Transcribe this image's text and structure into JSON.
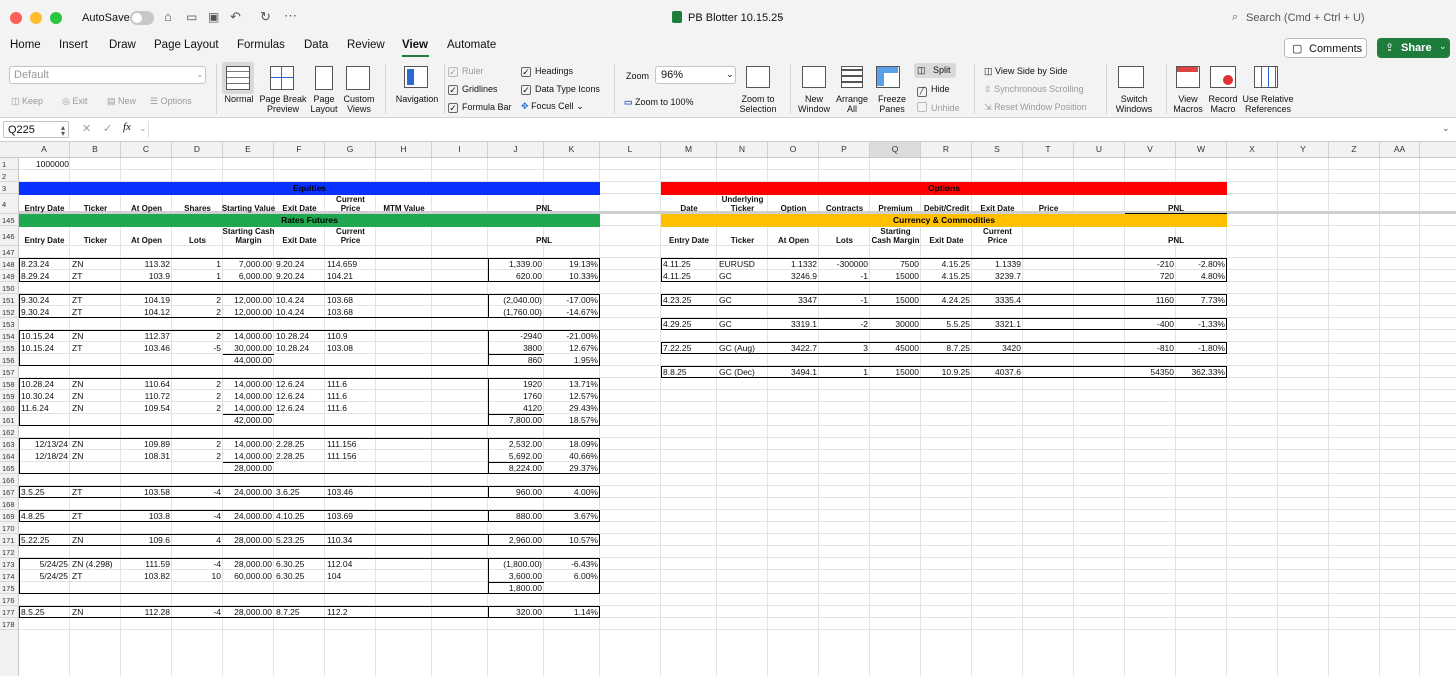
{
  "titlebar": {
    "autosave": "AutoSave",
    "doc_title": "PB Blotter  10.15.25",
    "search_placeholder": "Search (Cmd + Ctrl + U)"
  },
  "tabs": [
    "Home",
    "Insert",
    "Draw",
    "Page Layout",
    "Formulas",
    "Data",
    "Review",
    "View",
    "Automate"
  ],
  "active_tab": "View",
  "comments_label": "Comments",
  "share_label": "Share",
  "ribbon": {
    "sheet_view_value": "Default",
    "keep": "Keep",
    "exit": "Exit",
    "new": "New",
    "options": "Options",
    "normal": "Normal",
    "page_break": "Page Break\nPreview",
    "page_layout": "Page\nLayout",
    "custom_views": "Custom\nViews",
    "navigation": "Navigation",
    "ruler": "Ruler",
    "gridlines": "Gridlines",
    "formula_bar": "Formula Bar",
    "headings": "Headings",
    "data_type_icons": "Data Type Icons",
    "focus_cell": "Focus Cell",
    "zoom_label": "Zoom",
    "zoom_value": "96%",
    "zoom_100": "Zoom to 100%",
    "zoom_sel": "Zoom to\nSelection",
    "new_window": "New\nWindow",
    "arrange_all": "Arrange\nAll",
    "freeze": "Freeze\nPanes",
    "split": "Split",
    "hide": "Hide",
    "unhide": "Unhide",
    "side_by_side": "View Side by Side",
    "sync_scroll": "Synchronous Scrolling",
    "reset_pos": "Reset Window Position",
    "switch": "Switch\nWindows",
    "view_macros": "View\nMacros",
    "record_macro": "Record\nMacro",
    "relative": "Use Relative\nReferences"
  },
  "formula": {
    "name_box": "Q225",
    "fx": "fx",
    "content": ""
  },
  "columns": [
    "A",
    "B",
    "C",
    "D",
    "E",
    "F",
    "G",
    "H",
    "I",
    "J",
    "K",
    "L",
    "M",
    "N",
    "O",
    "P",
    "Q",
    "R",
    "S",
    "T",
    "U",
    "V",
    "W",
    "X",
    "Y",
    "Z",
    "AA"
  ],
  "rows": [
    "1",
    "2",
    "3",
    "4",
    "145",
    "146",
    "147",
    "148",
    "149",
    "150",
    "151",
    "152",
    "153",
    "154",
    "155",
    "156",
    "157",
    "158",
    "159",
    "160",
    "161",
    "162",
    "163",
    "164",
    "165",
    "166",
    "167",
    "168",
    "169",
    "170",
    "171",
    "172",
    "173",
    "174",
    "175",
    "176",
    "177",
    "178"
  ],
  "a1_value": "1000000",
  "sections": {
    "equities": "Equities",
    "options": "Options",
    "rates": "Rates Futures",
    "currency": "Currency & Commodities"
  },
  "equity_headers": [
    "Entry Date",
    "Ticker",
    "At Open",
    "Shares",
    "Starting Value",
    "Exit Date",
    "Current\nPrice",
    "MTM Value",
    "PNL"
  ],
  "options_headers": [
    "Date",
    "Underlying\nTicker",
    "Option",
    "Contracts",
    "Premium",
    "Debit/Credit",
    "Exit Date",
    "Price",
    "PNL"
  ],
  "rates_headers": [
    "Entry Date",
    "Ticker",
    "At Open",
    "Lots",
    "Starting Cash\nMargin",
    "Exit Date",
    "Current\nPrice",
    "PNL"
  ],
  "cc_headers": [
    "Entry Date",
    "Ticker",
    "At Open",
    "Lots",
    "Starting\nCash Margin",
    "Exit Date",
    "Current\nPrice",
    "PNL"
  ],
  "rates_rows": [
    {
      "row": 148,
      "a": "8.23.24",
      "b": "ZN",
      "c": "113.32",
      "d": "1",
      "e": "7,000.00",
      "f": "9.20.24",
      "g": "114.659",
      "j": "1,339.00",
      "k": "19.13%"
    },
    {
      "row": 149,
      "a": "8.29.24",
      "b": "ZT",
      "c": "103.9",
      "d": "1",
      "e": "6,000.00",
      "f": "9.20.24",
      "g": "104.21",
      "j": "620.00",
      "k": "10.33%"
    },
    {
      "row": 151,
      "a": "9.30.24",
      "b": "ZT",
      "c": "104.19",
      "d": "2",
      "e": "12,000.00",
      "f": "10.4.24",
      "g": "103.68",
      "j": "(2,040.00)",
      "k": "-17.00%"
    },
    {
      "row": 152,
      "a": "9.30.24",
      "b": "ZT",
      "c": "104.12",
      "d": "2",
      "e": "12,000.00",
      "f": "10.4.24",
      "g": "103.68",
      "j": "(1,760.00)",
      "k": "-14.67%"
    },
    {
      "row": 154,
      "a": "10.15.24",
      "b": "ZN",
      "c": "112.37",
      "d": "2",
      "e": "14,000.00",
      "f": "10.28.24",
      "g": "110.9",
      "j": "-2940",
      "k": "-21.00%"
    },
    {
      "row": 155,
      "a": "10.15.24",
      "b": "ZT",
      "c": "103.46",
      "d": "-5",
      "e": "30,000.00",
      "f": "10.28.24",
      "g": "103.08",
      "j": "3800",
      "k": "12.67%"
    },
    {
      "row": 156,
      "a": "",
      "b": "",
      "c": "",
      "d": "",
      "e": "44,000.00",
      "f": "",
      "g": "",
      "j": "860",
      "k": "1.95%"
    },
    {
      "row": 158,
      "a": "10.28.24",
      "b": "ZN",
      "c": "110.64",
      "d": "2",
      "e": "14,000.00",
      "f": "12.6.24",
      "g": "111.6",
      "j": "1920",
      "k": "13.71%"
    },
    {
      "row": 159,
      "a": "10.30.24",
      "b": "ZN",
      "c": "110.72",
      "d": "2",
      "e": "14,000.00",
      "f": "12.6.24",
      "g": "111.6",
      "j": "1760",
      "k": "12.57%"
    },
    {
      "row": 160,
      "a": "11.6.24",
      "b": "ZN",
      "c": "109.54",
      "d": "2",
      "e": "14,000.00",
      "f": "12.6.24",
      "g": "111.6",
      "j": "4120",
      "k": "29.43%"
    },
    {
      "row": 161,
      "a": "",
      "b": "",
      "c": "",
      "d": "",
      "e": "42,000.00",
      "f": "",
      "g": "",
      "j": "7,800.00",
      "k": "18.57%"
    },
    {
      "row": 163,
      "a": "12/13/24",
      "b": "ZN",
      "c": "109.89",
      "d": "2",
      "e": "14,000.00",
      "f": "2.28.25",
      "g": "111.156",
      "j": "2,532.00",
      "k": "18.09%",
      "ar": true
    },
    {
      "row": 164,
      "a": "12/18/24",
      "b": "ZN",
      "c": "108.31",
      "d": "2",
      "e": "14,000.00",
      "f": "2.28.25",
      "g": "111.156",
      "j": "5,692.00",
      "k": "40.66%",
      "ar": true
    },
    {
      "row": 165,
      "a": "",
      "b": "",
      "c": "",
      "d": "",
      "e": "28,000.00",
      "f": "",
      "g": "",
      "j": "8,224.00",
      "k": "29.37%"
    },
    {
      "row": 167,
      "a": "3.5.25",
      "b": "ZT",
      "c": "103.58",
      "d": "-4",
      "e": "24,000.00",
      "f": "3.6.25",
      "g": "103.46",
      "j": "960.00",
      "k": "4.00%"
    },
    {
      "row": 169,
      "a": "4.8.25",
      "b": "ZT",
      "c": "103.8",
      "d": "-4",
      "e": "24,000.00",
      "f": "4.10.25",
      "g": "103.69",
      "j": "880.00",
      "k": "3.67%"
    },
    {
      "row": 171,
      "a": "5.22.25",
      "b": "ZN",
      "c": "109.6",
      "d": "4",
      "e": "28,000.00",
      "f": "5.23.25",
      "g": "110.34",
      "j": "2,960.00",
      "k": "10.57%"
    },
    {
      "row": 173,
      "a": "5/24/25",
      "b": "ZN (4.298)",
      "c": "111.59",
      "d": "-4",
      "e": "28,000.00",
      "f": "6.30.25",
      "g": "112.04",
      "j": "(1,800.00)",
      "k": "-6.43%",
      "ar": true
    },
    {
      "row": 174,
      "a": "5/24/25",
      "b": "ZT",
      "c": "103.82",
      "d": "10",
      "e": "60,000.00",
      "f": "6.30.25",
      "g": "104",
      "j": "3,600.00",
      "k": "6.00%",
      "ar": true
    },
    {
      "row": 175,
      "a": "",
      "b": "",
      "c": "",
      "d": "",
      "e": "",
      "f": "",
      "g": "",
      "j": "1,800.00",
      "k": ""
    },
    {
      "row": 177,
      "a": "8.5.25",
      "b": "ZN",
      "c": "112.28",
      "d": "-4",
      "e": "28,000.00",
      "f": "8.7.25",
      "g": "112.2",
      "j": "320.00",
      "k": "1.14%"
    }
  ],
  "cc_rows": [
    {
      "row": 148,
      "m": "4.11.25",
      "n": "EURUSD",
      "o": "1.1332",
      "p": "-300000",
      "q": "7500",
      "r": "4.15.25",
      "s": "1.1339",
      "v": "-210",
      "w": "-2.80%"
    },
    {
      "row": 149,
      "m": "4.11.25",
      "n": "GC",
      "o": "3246.9",
      "p": "-1",
      "q": "15000",
      "r": "4.15.25",
      "s": "3239.7",
      "v": "720",
      "w": "4.80%"
    },
    {
      "row": 151,
      "m": "4.23.25",
      "n": "GC",
      "o": "3347",
      "p": "-1",
      "q": "15000",
      "r": "4.24.25",
      "s": "3335.4",
      "v": "1160",
      "w": "7.73%"
    },
    {
      "row": 153,
      "m": "4.29.25",
      "n": "GC",
      "o": "3319.1",
      "p": "-2",
      "q": "30000",
      "r": "5.5.25",
      "s": "3321.1",
      "v": "-400",
      "w": "-1.33%"
    },
    {
      "row": 155,
      "m": "7.22.25",
      "n": "GC (Aug)",
      "o": "3422.7",
      "p": "3",
      "q": "45000",
      "r": "8.7.25",
      "s": "3420",
      "v": "-810",
      "w": "-1.80%"
    },
    {
      "row": 157,
      "m": "8.8.25",
      "n": "GC (Dec)",
      "o": "3494.1",
      "p": "1",
      "q": "15000",
      "r": "10.9.25",
      "s": "4037.6",
      "v": "54350",
      "w": "362.33%"
    }
  ],
  "colors": {
    "equities": "#0a31ff",
    "options": "#ff0000",
    "rates": "#1fa84f",
    "currency": "#ffc000",
    "share": "#1e7d3a"
  }
}
